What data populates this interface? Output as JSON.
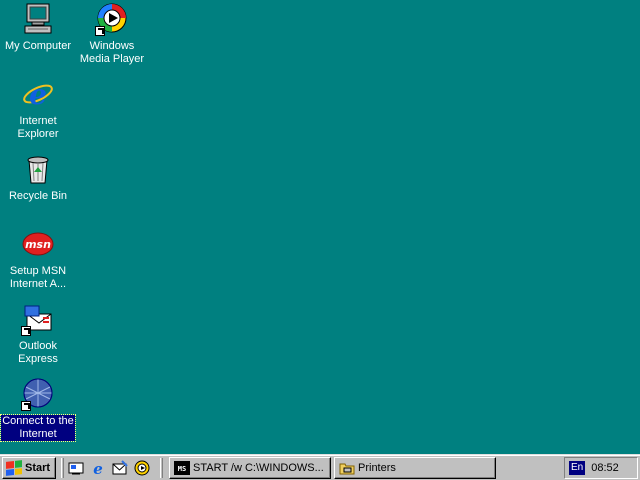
{
  "desktop": {
    "background_color": "#008080",
    "icons": [
      {
        "name": "My Computer",
        "label": "My Computer",
        "icon": "my-computer-icon"
      },
      {
        "name": "Windows Media Player",
        "label": "Windows\nMedia Player",
        "icon": "media-player-icon"
      },
      {
        "name": "Internet Explorer",
        "label": "Internet\nExplorer",
        "icon": "internet-explorer-icon"
      },
      {
        "name": "Recycle Bin",
        "label": "Recycle Bin",
        "icon": "recycle-bin-icon"
      },
      {
        "name": "Setup MSN",
        "label": "Setup MSN\nInternet A...",
        "icon": "msn-icon"
      },
      {
        "name": "Outlook Express",
        "label": "Outlook\nExpress",
        "icon": "outlook-express-icon"
      },
      {
        "name": "Connect to the Internet",
        "label": "Connect to the\nInternet",
        "icon": "connect-internet-icon",
        "selected": true
      }
    ]
  },
  "taskbar": {
    "start_label": "Start",
    "quick_launch": [
      "show-desktop-icon",
      "internet-explorer-icon",
      "outlook-express-icon",
      "media-player-icon"
    ],
    "tasks": [
      {
        "label": "START /w C:\\WINDOWS...",
        "icon": "msdos-icon"
      },
      {
        "label": "Printers",
        "icon": "printers-folder-icon"
      }
    ],
    "tray": {
      "language": "En",
      "clock": "08:52"
    }
  }
}
